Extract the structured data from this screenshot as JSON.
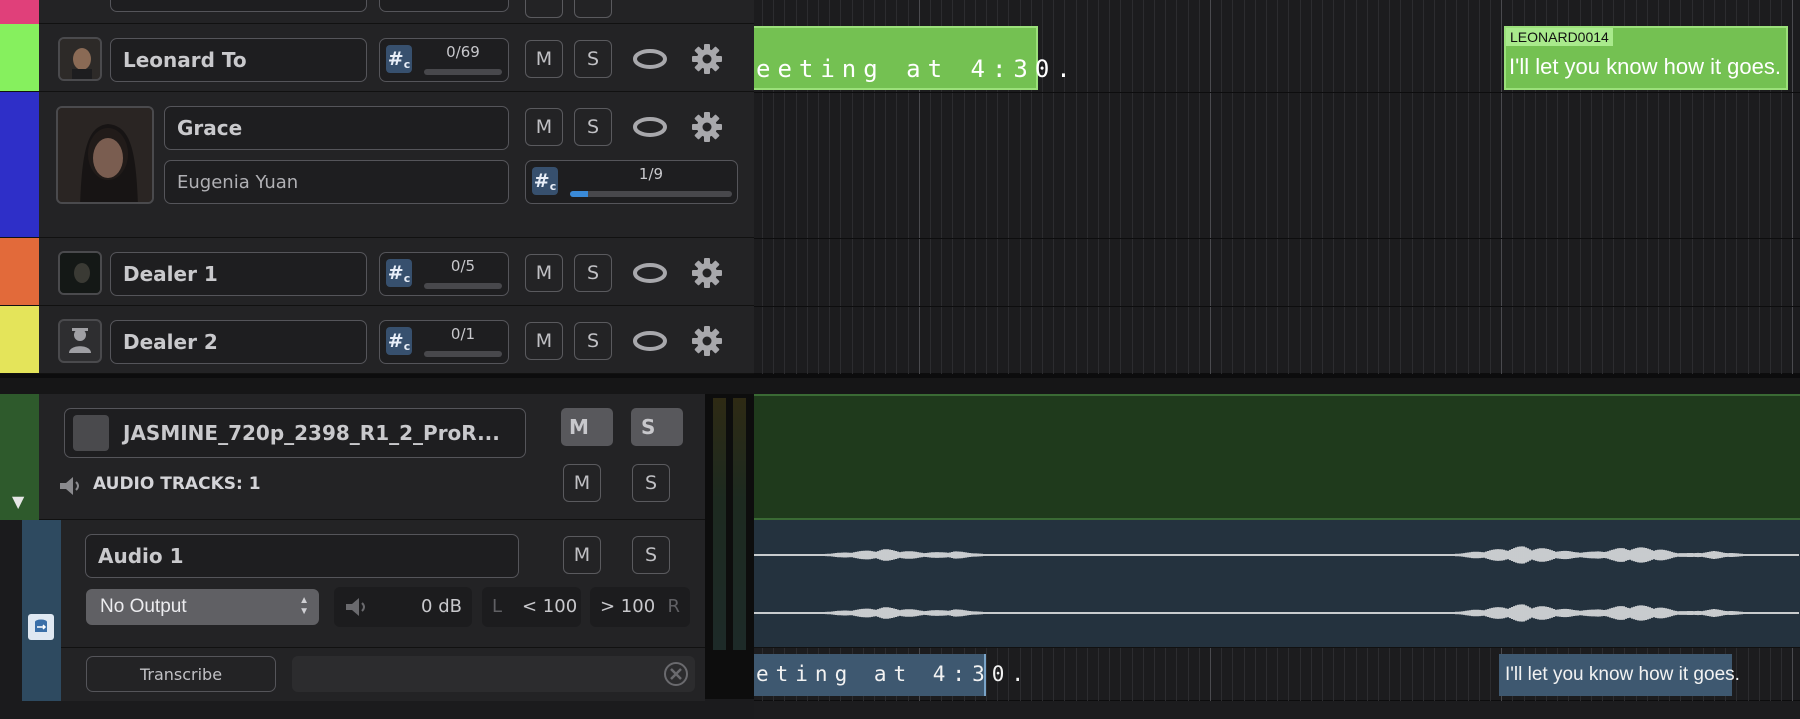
{
  "tracks": [
    {
      "name": "Leonard To",
      "counter": "0/69",
      "progress": 0,
      "color": "#86f05e"
    },
    {
      "name": "Grace",
      "actor": "Eugenia Yuan",
      "counter": "1/9",
      "progress": 0.11,
      "color": "#2e2fc8"
    },
    {
      "name": "Dealer 1",
      "counter": "0/5",
      "progress": 0,
      "color": "#e26a3a"
    },
    {
      "name": "Dealer 2",
      "counter": "0/1",
      "progress": 0,
      "color": "#e4e45a"
    }
  ],
  "top_strip_color": "#e0407a",
  "buttons": {
    "mute": "M",
    "solo": "S"
  },
  "counter_icon": {
    "hash": "#",
    "sub": "c"
  },
  "video": {
    "name": "JASMINE_720p_2398_R1_2_ProR...",
    "audio_tracks_label": "AUDIO TRACKS:",
    "audio_tracks_count": "1",
    "strip_color": "#2e5a2c",
    "collapse_glyph": "▼"
  },
  "audio": {
    "name": "Audio 1",
    "output": "No Output",
    "gain": "0 dB",
    "pan_left": "L",
    "pan_left_val": "< 100",
    "pan_right_val": "> 100",
    "pan_right": "R"
  },
  "transcribe": {
    "label": "Transcribe",
    "placeholder": ""
  },
  "timeline": {
    "leonard_clip_left_text": "eeting at 4:30.",
    "leonard_clip_right_id": "LEONARD0014",
    "leonard_clip_right_text": "I'll let you know how it goes.",
    "sub_left_text": "eting at 4:30.",
    "sub_right_text": "I'll let you know how it goes."
  }
}
